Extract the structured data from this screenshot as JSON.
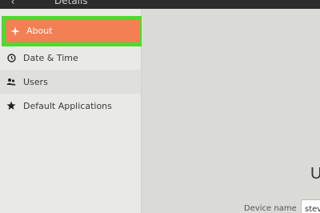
{
  "header": {
    "title": "Details",
    "back_icon": "chevron-left-icon"
  },
  "sidebar": {
    "items": [
      {
        "label": "About",
        "icon": "sparkle-icon",
        "selected": true
      },
      {
        "label": "Date & Time",
        "icon": "clock-icon"
      },
      {
        "label": "Users",
        "icon": "users-icon"
      },
      {
        "label": "Default Applications",
        "icon": "star-icon"
      }
    ]
  },
  "main": {
    "title_fragment": "U",
    "device_name_label": "Device name",
    "device_name_value": "steve"
  },
  "colors": {
    "selected_item": "#f37f54",
    "highlight_frame": "#4fd92f",
    "header_bar": "#2c2c2c"
  }
}
